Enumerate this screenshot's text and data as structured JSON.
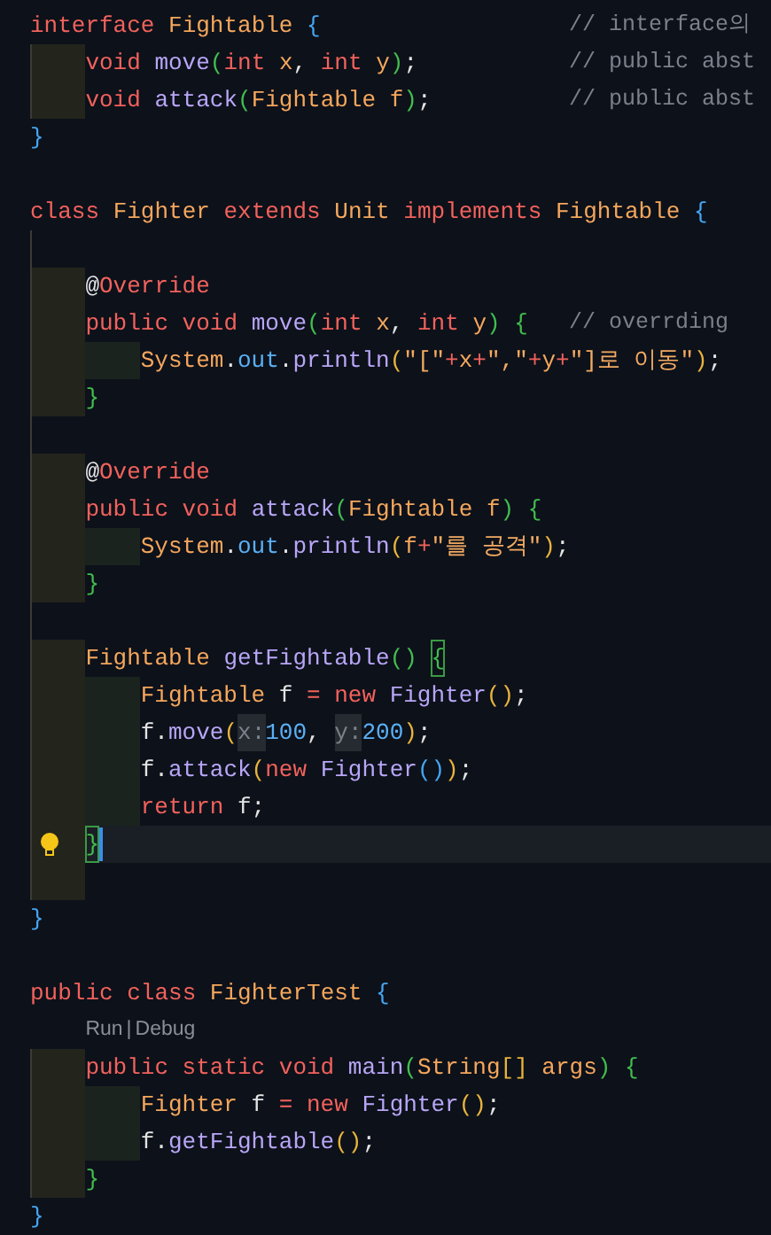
{
  "editor": {
    "lines": [
      {
        "kind": "code",
        "current": false,
        "comment": "// interface의",
        "tokens": [
          {
            "kind": "kw",
            "text": "interface "
          },
          {
            "kind": "type",
            "text": "Fightable "
          },
          {
            "kind": "b1",
            "text": "{"
          }
        ]
      },
      {
        "kind": "code",
        "current": false,
        "comment": "// public abst",
        "tokens": [
          {
            "kind": "indent"
          },
          {
            "kind": "kw",
            "text": "void "
          },
          {
            "kind": "fn",
            "text": "move"
          },
          {
            "kind": "b2",
            "text": "("
          },
          {
            "kind": "kw",
            "text": "int "
          },
          {
            "kind": "param",
            "text": "x"
          },
          {
            "kind": "p",
            "text": ", "
          },
          {
            "kind": "kw",
            "text": "int "
          },
          {
            "kind": "param",
            "text": "y"
          },
          {
            "kind": "b2",
            "text": ")"
          },
          {
            "kind": "p",
            "text": ";"
          }
        ]
      },
      {
        "kind": "code",
        "current": false,
        "comment": "// public abst",
        "tokens": [
          {
            "kind": "indent"
          },
          {
            "kind": "kw",
            "text": "void "
          },
          {
            "kind": "fn",
            "text": "attack"
          },
          {
            "kind": "b2",
            "text": "("
          },
          {
            "kind": "type",
            "text": "Fightable "
          },
          {
            "kind": "param",
            "text": "f"
          },
          {
            "kind": "b2",
            "text": ")"
          },
          {
            "kind": "p",
            "text": ";"
          }
        ]
      },
      {
        "kind": "code",
        "current": false,
        "tokens": [
          {
            "kind": "b1",
            "text": "}"
          }
        ]
      },
      {
        "kind": "blank",
        "guide": false
      },
      {
        "kind": "code",
        "current": false,
        "tokens": [
          {
            "kind": "kw",
            "text": "class "
          },
          {
            "kind": "type",
            "text": "Fighter "
          },
          {
            "kind": "kw",
            "text": "extends "
          },
          {
            "kind": "type",
            "text": "Unit "
          },
          {
            "kind": "kw",
            "text": "implements "
          },
          {
            "kind": "type",
            "text": "Fightable "
          },
          {
            "kind": "b1",
            "text": "{"
          }
        ]
      },
      {
        "kind": "blank",
        "guide": true
      },
      {
        "kind": "code",
        "current": false,
        "tokens": [
          {
            "kind": "indent"
          },
          {
            "kind": "p",
            "text": "@"
          },
          {
            "kind": "kw",
            "text": "Override"
          }
        ]
      },
      {
        "kind": "code",
        "current": false,
        "comment": "// overrding",
        "tokens": [
          {
            "kind": "indent"
          },
          {
            "kind": "kw",
            "text": "public void "
          },
          {
            "kind": "fn",
            "text": "move"
          },
          {
            "kind": "b2",
            "text": "("
          },
          {
            "kind": "kw",
            "text": "int "
          },
          {
            "kind": "param",
            "text": "x"
          },
          {
            "kind": "p",
            "text": ", "
          },
          {
            "kind": "kw",
            "text": "int "
          },
          {
            "kind": "param",
            "text": "y"
          },
          {
            "kind": "b2",
            "text": ") {"
          }
        ]
      },
      {
        "kind": "code",
        "current": false,
        "tokens": [
          {
            "kind": "indent"
          },
          {
            "kind": "indent"
          },
          {
            "kind": "type",
            "text": "System"
          },
          {
            "kind": "p",
            "text": "."
          },
          {
            "kind": "field",
            "text": "out"
          },
          {
            "kind": "p",
            "text": "."
          },
          {
            "kind": "fn",
            "text": "println"
          },
          {
            "kind": "b3",
            "text": "("
          },
          {
            "kind": "str",
            "text": "\"[\""
          },
          {
            "kind": "kw",
            "text": "+"
          },
          {
            "kind": "param",
            "text": "x"
          },
          {
            "kind": "kw",
            "text": "+"
          },
          {
            "kind": "str",
            "text": "\",\""
          },
          {
            "kind": "kw",
            "text": "+"
          },
          {
            "kind": "param",
            "text": "y"
          },
          {
            "kind": "kw",
            "text": "+"
          },
          {
            "kind": "str",
            "text": "\"]로 이동\""
          },
          {
            "kind": "b3",
            "text": ")"
          },
          {
            "kind": "p",
            "text": ";"
          }
        ]
      },
      {
        "kind": "code",
        "current": false,
        "tokens": [
          {
            "kind": "indent"
          },
          {
            "kind": "b2",
            "text": "}"
          }
        ]
      },
      {
        "kind": "blank",
        "guide": true
      },
      {
        "kind": "code",
        "current": false,
        "tokens": [
          {
            "kind": "indent"
          },
          {
            "kind": "p",
            "text": "@"
          },
          {
            "kind": "kw",
            "text": "Override"
          }
        ]
      },
      {
        "kind": "code",
        "current": false,
        "tokens": [
          {
            "kind": "indent"
          },
          {
            "kind": "kw",
            "text": "public void "
          },
          {
            "kind": "fn",
            "text": "attack"
          },
          {
            "kind": "b2",
            "text": "("
          },
          {
            "kind": "type",
            "text": "Fightable "
          },
          {
            "kind": "param",
            "text": "f"
          },
          {
            "kind": "b2",
            "text": ") {"
          }
        ]
      },
      {
        "kind": "code",
        "current": false,
        "tokens": [
          {
            "kind": "indent"
          },
          {
            "kind": "indent"
          },
          {
            "kind": "type",
            "text": "System"
          },
          {
            "kind": "p",
            "text": "."
          },
          {
            "kind": "field",
            "text": "out"
          },
          {
            "kind": "p",
            "text": "."
          },
          {
            "kind": "fn",
            "text": "println"
          },
          {
            "kind": "b3",
            "text": "("
          },
          {
            "kind": "param",
            "text": "f"
          },
          {
            "kind": "kw",
            "text": "+"
          },
          {
            "kind": "str",
            "text": "\"를 공격\""
          },
          {
            "kind": "b3",
            "text": ")"
          },
          {
            "kind": "p",
            "text": ";"
          }
        ]
      },
      {
        "kind": "code",
        "current": false,
        "tokens": [
          {
            "kind": "indent"
          },
          {
            "kind": "b2",
            "text": "}"
          }
        ]
      },
      {
        "kind": "blank",
        "guide": true
      },
      {
        "kind": "code",
        "current": false,
        "tokens": [
          {
            "kind": "indent"
          },
          {
            "kind": "type",
            "text": "Fightable "
          },
          {
            "kind": "fn",
            "text": "getFightable"
          },
          {
            "kind": "b2",
            "text": "() "
          },
          {
            "kind": "match",
            "text": "{"
          }
        ]
      },
      {
        "kind": "code",
        "current": false,
        "tokens": [
          {
            "kind": "indent"
          },
          {
            "kind": "indent"
          },
          {
            "kind": "type",
            "text": "Fightable "
          },
          {
            "kind": "p",
            "text": "f "
          },
          {
            "kind": "kw",
            "text": "= new "
          },
          {
            "kind": "fn",
            "text": "Fighter"
          },
          {
            "kind": "b3",
            "text": "()"
          },
          {
            "kind": "p",
            "text": ";"
          }
        ]
      },
      {
        "kind": "code",
        "current": false,
        "tokens": [
          {
            "kind": "indent"
          },
          {
            "kind": "indent"
          },
          {
            "kind": "p",
            "text": "f."
          },
          {
            "kind": "fn",
            "text": "move"
          },
          {
            "kind": "b3",
            "text": "("
          },
          {
            "kind": "hint",
            "text": "x:"
          },
          {
            "kind": "num",
            "text": "100"
          },
          {
            "kind": "p",
            "text": ", "
          },
          {
            "kind": "hint",
            "text": "y:"
          },
          {
            "kind": "num",
            "text": "200"
          },
          {
            "kind": "b3",
            "text": ")"
          },
          {
            "kind": "p",
            "text": ";"
          }
        ]
      },
      {
        "kind": "code",
        "current": false,
        "tokens": [
          {
            "kind": "indent"
          },
          {
            "kind": "indent"
          },
          {
            "kind": "p",
            "text": "f."
          },
          {
            "kind": "fn",
            "text": "attack"
          },
          {
            "kind": "b3",
            "text": "("
          },
          {
            "kind": "kw",
            "text": "new "
          },
          {
            "kind": "fn",
            "text": "Fighter"
          },
          {
            "kind": "b1",
            "text": "()"
          },
          {
            "kind": "b3",
            "text": ")"
          },
          {
            "kind": "p",
            "text": ";"
          }
        ]
      },
      {
        "kind": "code",
        "current": false,
        "tokens": [
          {
            "kind": "indent"
          },
          {
            "kind": "indent"
          },
          {
            "kind": "kw",
            "text": "return "
          },
          {
            "kind": "p",
            "text": "f;"
          }
        ]
      },
      {
        "kind": "code",
        "current": true,
        "tokens": [
          {
            "kind": "indent"
          },
          {
            "kind": "match",
            "text": "}"
          }
        ]
      },
      {
        "kind": "code",
        "current": false,
        "tokens": [
          {
            "kind": "indent"
          }
        ]
      },
      {
        "kind": "code",
        "current": false,
        "tokens": [
          {
            "kind": "b1",
            "text": "}"
          }
        ]
      },
      {
        "kind": "blank",
        "guide": false
      },
      {
        "kind": "code",
        "current": false,
        "tokens": [
          {
            "kind": "kw",
            "text": "public class "
          },
          {
            "kind": "type",
            "text": "FighterTest "
          },
          {
            "kind": "b1",
            "text": "{"
          }
        ]
      },
      {
        "kind": "codelens",
        "links": [
          "Run",
          "Debug"
        ],
        "separator": "|"
      },
      {
        "kind": "code",
        "current": false,
        "tokens": [
          {
            "kind": "indent"
          },
          {
            "kind": "kw",
            "text": "public static void "
          },
          {
            "kind": "fn",
            "text": "main"
          },
          {
            "kind": "b2",
            "text": "("
          },
          {
            "kind": "type",
            "text": "String"
          },
          {
            "kind": "b3",
            "text": "[] "
          },
          {
            "kind": "param",
            "text": "args"
          },
          {
            "kind": "b2",
            "text": ") {"
          }
        ]
      },
      {
        "kind": "code",
        "current": false,
        "tokens": [
          {
            "kind": "indent"
          },
          {
            "kind": "indent"
          },
          {
            "kind": "type",
            "text": "Fighter "
          },
          {
            "kind": "p",
            "text": "f "
          },
          {
            "kind": "kw",
            "text": "= new "
          },
          {
            "kind": "fn",
            "text": "Fighter"
          },
          {
            "kind": "b3",
            "text": "()"
          },
          {
            "kind": "p",
            "text": ";"
          }
        ]
      },
      {
        "kind": "code",
        "current": false,
        "tokens": [
          {
            "kind": "indent"
          },
          {
            "kind": "indent"
          },
          {
            "kind": "p",
            "text": "f."
          },
          {
            "kind": "fn",
            "text": "getFightable"
          },
          {
            "kind": "b3",
            "text": "()"
          },
          {
            "kind": "p",
            "text": ";"
          }
        ]
      },
      {
        "kind": "code",
        "current": false,
        "tokens": [
          {
            "kind": "indent"
          },
          {
            "kind": "b2",
            "text": "}"
          }
        ]
      },
      {
        "kind": "code",
        "current": false,
        "tokens": [
          {
            "kind": "b1",
            "text": "}"
          }
        ]
      }
    ]
  }
}
